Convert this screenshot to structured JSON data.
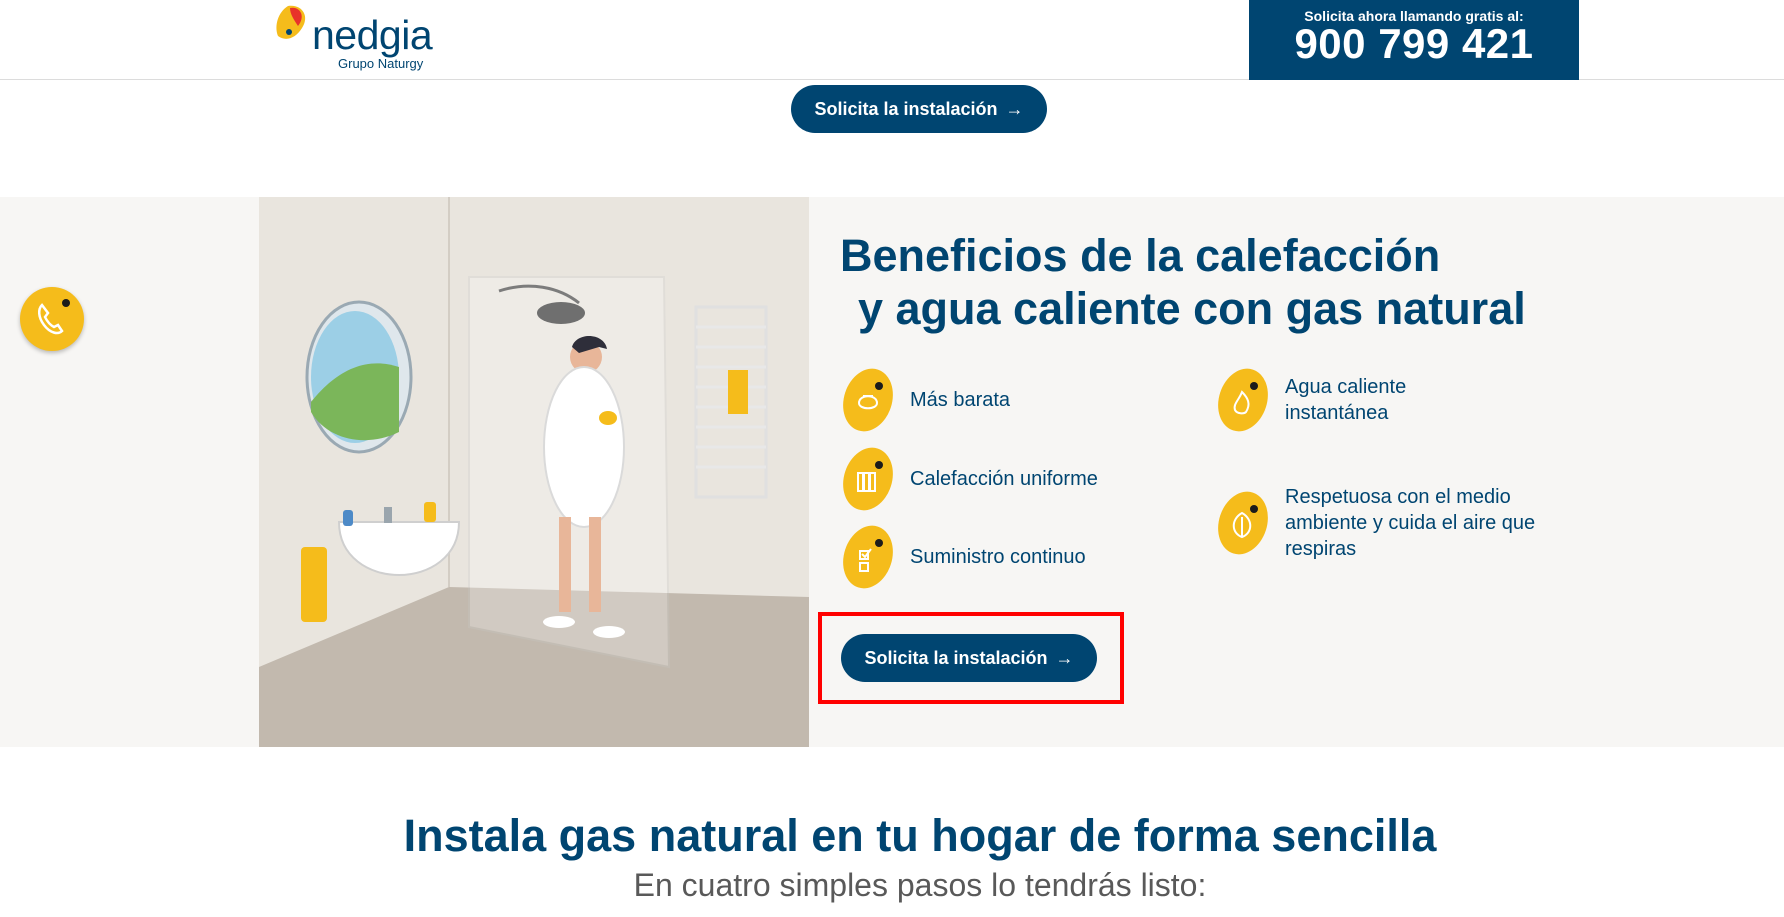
{
  "header": {
    "logo": {
      "name": "nedgia",
      "subtitle": "Grupo Naturgy"
    },
    "call": {
      "label": "Solicita ahora llamando gratis al:",
      "number": "900 799 421"
    }
  },
  "cta_top": {
    "label": "Solicita la instalación",
    "icon": "arrow-right-icon"
  },
  "benefits": {
    "title_line1": "Beneficios de la calefacción",
    "title_line2": "y agua caliente con gas natural",
    "items": [
      {
        "label": "Más barata",
        "icon": "piggy-bank-icon"
      },
      {
        "label": "Calefacción uniforme",
        "icon": "radiator-icon"
      },
      {
        "label": "Suministro continuo",
        "icon": "checklist-icon"
      },
      {
        "label": "Agua caliente instantánea",
        "icon": "flame-icon"
      },
      {
        "label": "Respetuosa con el medio ambiente y cuida el aire que respiras",
        "icon": "leaf-icon"
      }
    ],
    "cta": {
      "label": "Solicita la instalación",
      "icon": "arrow-right-icon"
    }
  },
  "floating": {
    "icon": "phone-icon"
  },
  "install": {
    "title": "Instala gas natural en tu  hogar de forma sencilla",
    "subtitle": "En cuatro simples pasos lo tendrás listo:"
  },
  "colors": {
    "brand": "#004571",
    "accent": "#f5bc1b",
    "highlight": "#ff0000"
  }
}
